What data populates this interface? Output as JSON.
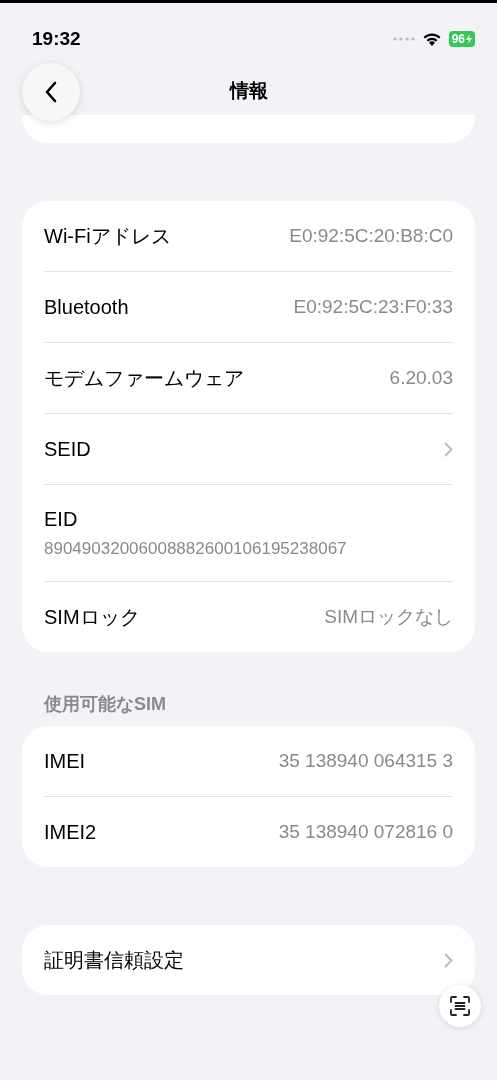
{
  "status_bar": {
    "time": "19:32",
    "battery": "96"
  },
  "nav": {
    "title": "情報"
  },
  "sections": [
    {
      "rows": [
        {
          "kind": "value",
          "label": "Wi-Fiアドレス",
          "value": "E0:92:5C:20:B8:C0"
        },
        {
          "kind": "value",
          "label": "Bluetooth",
          "value": "E0:92:5C:23:F0:33"
        },
        {
          "kind": "value",
          "label": "モデムファームウェア",
          "value": "6.20.03"
        },
        {
          "kind": "chevron",
          "label": "SEID"
        },
        {
          "kind": "stacked",
          "label": "EID",
          "value": "89049032006008882600106195238067"
        },
        {
          "kind": "value",
          "label": "SIMロック",
          "value": "SIMロックなし"
        }
      ]
    },
    {
      "header": "使用可能なSIM",
      "rows": [
        {
          "kind": "value",
          "label": "IMEI",
          "value": "35 138940 064315 3"
        },
        {
          "kind": "value",
          "label": "IMEI2",
          "value": "35 138940 072816 0"
        }
      ]
    },
    {
      "rows": [
        {
          "kind": "chevron",
          "label": "証明書信頼設定"
        }
      ]
    }
  ]
}
